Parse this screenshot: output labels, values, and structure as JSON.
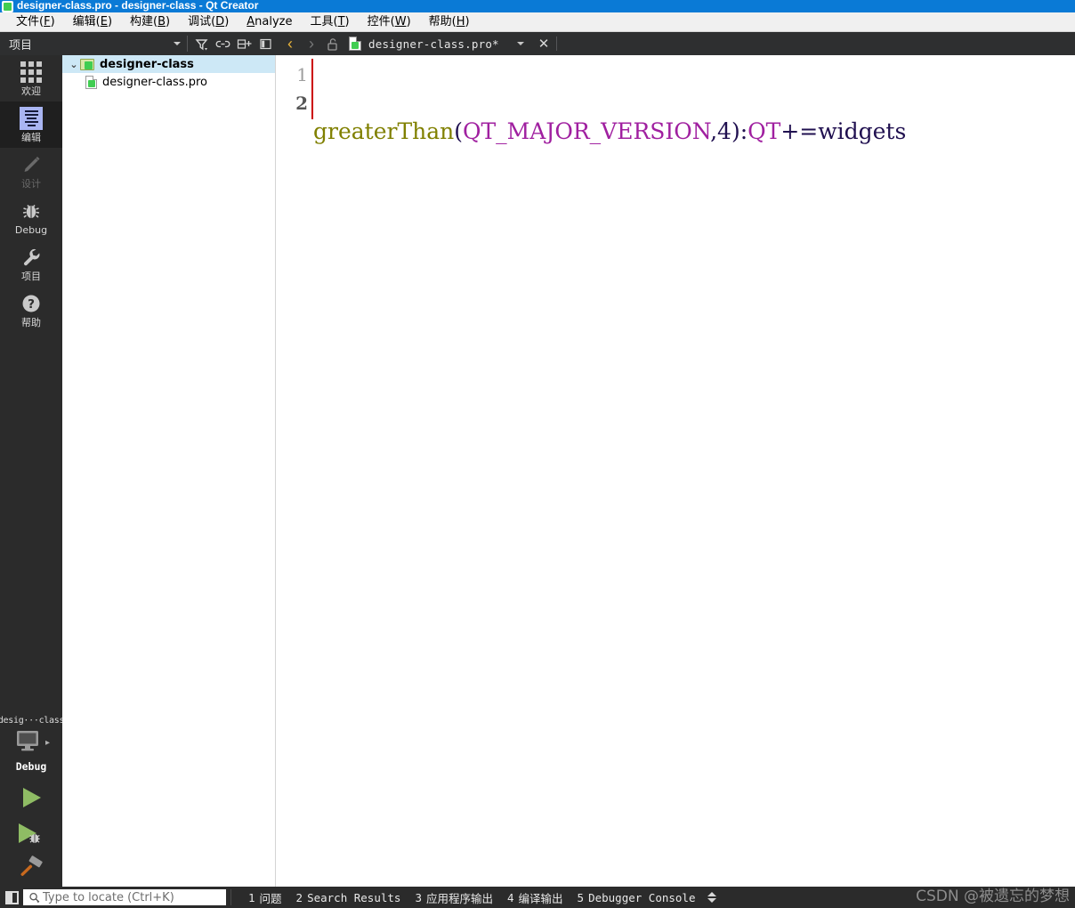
{
  "window": {
    "title": "designer-class.pro - designer-class - Qt Creator",
    "logo_icon": "qt-logo-icon"
  },
  "menubar": {
    "items": [
      {
        "label": "文件(F)",
        "mnemonic": "F",
        "name": "menu-file"
      },
      {
        "label": "编辑(E)",
        "mnemonic": "E",
        "name": "menu-edit"
      },
      {
        "label": "构建(B)",
        "mnemonic": "B",
        "name": "menu-build"
      },
      {
        "label": "调试(D)",
        "mnemonic": "D",
        "name": "menu-debug"
      },
      {
        "label": "Analyze",
        "mnemonic": "A",
        "name": "menu-analyze"
      },
      {
        "label": "工具(T)",
        "mnemonic": "T",
        "name": "menu-tools"
      },
      {
        "label": "控件(W)",
        "mnemonic": "W",
        "name": "menu-window"
      },
      {
        "label": "帮助(H)",
        "mnemonic": "H",
        "name": "menu-help"
      }
    ]
  },
  "project_toolbar": {
    "view_selector_value": "项目",
    "buttons": [
      {
        "name": "filter-icon",
        "tooltip": "筛选树"
      },
      {
        "name": "link-icon",
        "tooltip": "与编辑器同步"
      },
      {
        "name": "split-icon",
        "tooltip": "添加新项"
      },
      {
        "name": "sidebar-icon",
        "tooltip": "关闭侧边栏"
      }
    ]
  },
  "editor_toolbar": {
    "back_label": "‹",
    "forward_label": "›",
    "lock_icon": "unlocked-padlock-icon",
    "tab_title": "designer-class.pro*",
    "tab_dropdown": "▾",
    "close_label": "✕"
  },
  "modebar": {
    "items": [
      {
        "label": "欢迎",
        "icon": "grid-icon",
        "state": "normal",
        "name": "mode-welcome"
      },
      {
        "label": "编辑",
        "icon": "edit-document-icon",
        "state": "active",
        "name": "mode-edit"
      },
      {
        "label": "设计",
        "icon": "pencil-icon",
        "state": "disabled",
        "name": "mode-design"
      },
      {
        "label": "Debug",
        "icon": "bug-icon",
        "state": "normal",
        "name": "mode-debug"
      },
      {
        "label": "项目",
        "icon": "wrench-icon",
        "state": "normal",
        "name": "mode-projects"
      },
      {
        "label": "帮助",
        "icon": "question-mark-icon",
        "state": "normal",
        "name": "mode-help"
      }
    ],
    "kit_selector": {
      "project_name": "desig···class",
      "device_icon": "desktop-monitor-icon",
      "build_config": "Debug",
      "expand_arrow": "▸"
    },
    "actions": [
      {
        "name": "run-button",
        "icon": "green-play-triangle-icon",
        "label": "Run"
      },
      {
        "name": "debug-button",
        "icon": "play-with-bug-icon",
        "label": "Start Debugging"
      },
      {
        "name": "build-button",
        "icon": "hammer-icon",
        "label": "Build"
      }
    ]
  },
  "project_tree": {
    "nodes": [
      {
        "label": "designer-class",
        "icon": "qt-project-folder-icon",
        "twisty": "⌄",
        "selected": true,
        "bold": true,
        "depth": 0
      },
      {
        "label": "designer-class.pro",
        "icon": "qt-pro-file-icon",
        "selected": false,
        "bold": false,
        "depth": 1
      }
    ]
  },
  "editor": {
    "line_numbers": [
      "1",
      "2"
    ],
    "current_line": 2,
    "code_tokens": [
      {
        "text": "greaterThan",
        "cls": "tok-func"
      },
      {
        "text": "(",
        "cls": "tok-punc"
      },
      {
        "text": "QT_MAJOR_VERSION",
        "cls": "tok-var"
      },
      {
        "text": ",",
        "cls": "tok-punc"
      },
      {
        "text": "4",
        "cls": "tok-num"
      },
      {
        "text": ")",
        "cls": "tok-punc"
      },
      {
        "text": ":",
        "cls": "tok-punc"
      },
      {
        "text": "QT",
        "cls": "tok-var"
      },
      {
        "text": "+=widgets",
        "cls": "tok-plain"
      }
    ],
    "code_line_1": "greaterThan(QT_MAJOR_VERSION,4):QT+=widgets",
    "code_line_2": ""
  },
  "statusbar": {
    "sidebar_toggle_icon": "toggle-sidebar-icon",
    "locator": {
      "placeholder": "Type to locate (Ctrl+K)",
      "value": "",
      "icon": "magnifier-icon"
    },
    "output_panes": [
      {
        "num": "1",
        "label": "问题",
        "name": "output-pane-issues"
      },
      {
        "num": "2",
        "label": "Search Results",
        "name": "output-pane-search-results"
      },
      {
        "num": "3",
        "label": "应用程序输出",
        "name": "output-pane-application-output"
      },
      {
        "num": "4",
        "label": "编译输出",
        "name": "output-pane-compile-output"
      },
      {
        "num": "5",
        "label": "Debugger Console",
        "name": "output-pane-debugger-console"
      }
    ]
  },
  "watermark": {
    "text": "CSDN @被遗忘的梦想"
  },
  "colors": {
    "titlebar": "#0a7ad6",
    "menubar": "#f0f0f0",
    "toolbar_dark": "#2e2f30",
    "modebar": "#2b2b2b",
    "mode_active": "#1f1f1f",
    "tree_selection": "#cde8f6",
    "accent_green": "#41cd52",
    "nav_back": "#e8b33a",
    "cursor_red": "#cc0000",
    "token_function": "#808000",
    "token_variable": "#a020a0",
    "token_plain": "#201050"
  }
}
